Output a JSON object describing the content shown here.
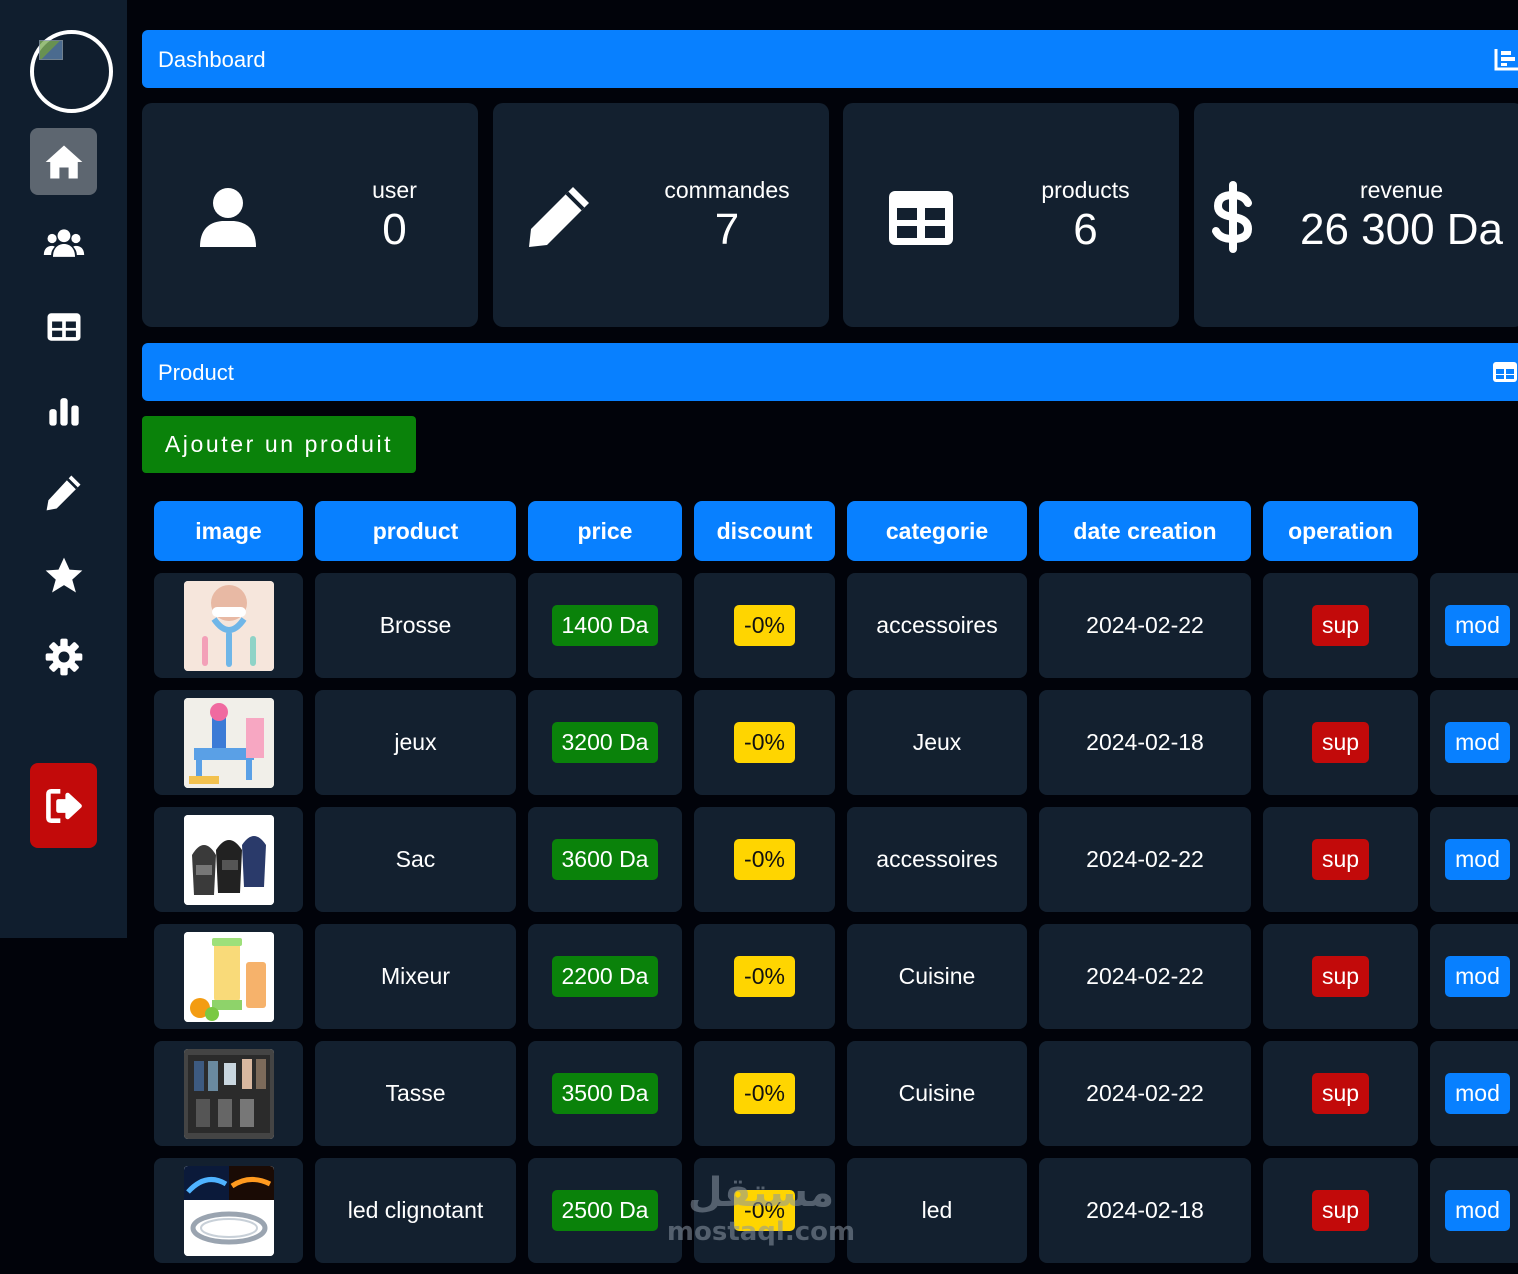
{
  "sidebar": {
    "avatar_icon": "user-avatar",
    "items": [
      {
        "icon": "home-icon",
        "active": true
      },
      {
        "icon": "users-icon",
        "active": false
      },
      {
        "icon": "table-icon",
        "active": false
      },
      {
        "icon": "chart-bar-icon",
        "active": false
      },
      {
        "icon": "pencil-icon",
        "active": false
      },
      {
        "icon": "star-icon",
        "active": false
      },
      {
        "icon": "gear-icon",
        "active": false
      }
    ],
    "logout_icon": "sign-out-icon"
  },
  "dashboard_bar": {
    "title": "Dashboard",
    "icon": "chart-area-icon"
  },
  "stats": [
    {
      "label": "user",
      "value": "0",
      "icon": "user-icon"
    },
    {
      "label": "commandes",
      "value": "7",
      "icon": "pencil-icon"
    },
    {
      "label": "products",
      "value": "6",
      "icon": "table-icon"
    },
    {
      "label": "revenue",
      "value": "26 300 Da",
      "icon": "dollar-icon"
    }
  ],
  "product_bar": {
    "title": "Product",
    "icon": "table-icon"
  },
  "add_button": "Ajouter un produit",
  "table": {
    "headers": [
      "image",
      "product",
      "price",
      "discount",
      "categorie",
      "date creation",
      "operation"
    ],
    "rows": [
      {
        "image": "toothbrush-image",
        "product": "Brosse",
        "price": "1400 Da",
        "discount": "-0%",
        "categorie": "accessoires",
        "date": "2024-02-22",
        "sup": "sup",
        "mod": "mod"
      },
      {
        "image": "toy-table-image",
        "product": "jeux",
        "price": "3200 Da",
        "discount": "-0%",
        "categorie": "Jeux",
        "date": "2024-02-18",
        "sup": "sup",
        "mod": "mod"
      },
      {
        "image": "bags-image",
        "product": "Sac",
        "price": "3600 Da",
        "discount": "-0%",
        "categorie": "accessoires",
        "date": "2024-02-22",
        "sup": "sup",
        "mod": "mod"
      },
      {
        "image": "blender-image",
        "product": "Mixeur",
        "price": "2200 Da",
        "discount": "-0%",
        "categorie": "Cuisine",
        "date": "2024-02-22",
        "sup": "sup",
        "mod": "mod"
      },
      {
        "image": "cups-image",
        "product": "Tasse",
        "price": "3500 Da",
        "discount": "-0%",
        "categorie": "Cuisine",
        "date": "2024-02-22",
        "sup": "sup",
        "mod": "mod"
      },
      {
        "image": "led-strip-image",
        "product": "led clignotant",
        "price": "2500 Da",
        "discount": "-0%",
        "categorie": "led",
        "date": "2024-02-18",
        "sup": "sup",
        "mod": "mod"
      }
    ]
  },
  "colors": {
    "bg": "#01030a",
    "panel": "#13202f",
    "sidebar": "#101e2e",
    "primary": "#0880ff",
    "green": "#0a820a",
    "yellow": "#ffd500",
    "red": "#c20a0a"
  },
  "watermark": {
    "text": "mostaql.com"
  }
}
